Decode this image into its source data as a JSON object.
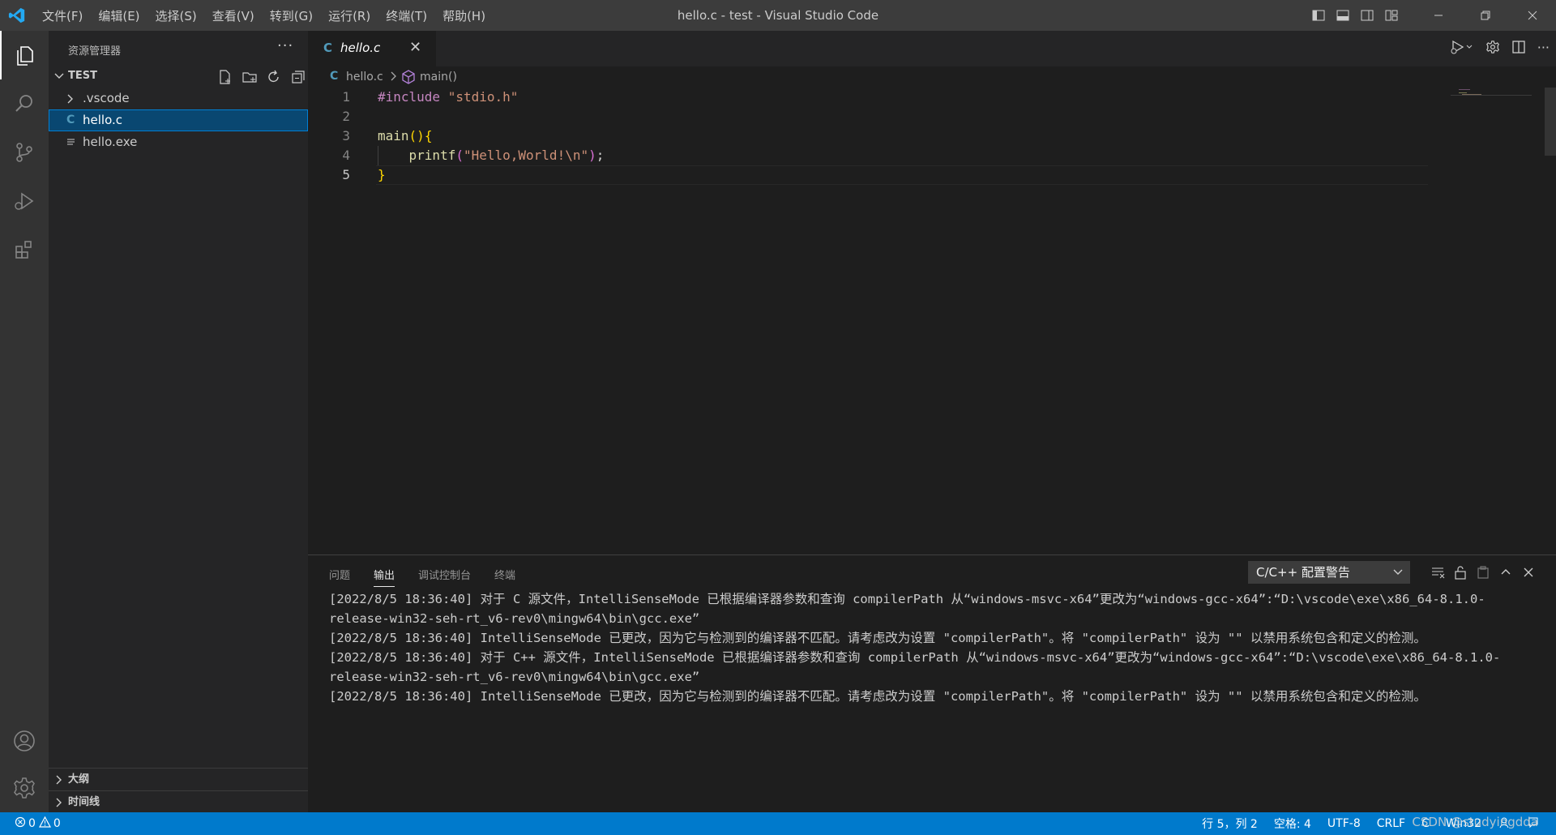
{
  "window": {
    "title": "hello.c - test - Visual Studio Code",
    "menu": [
      "文件(F)",
      "编辑(E)",
      "选择(S)",
      "查看(V)",
      "转到(G)",
      "运行(R)",
      "终端(T)",
      "帮助(H)"
    ]
  },
  "sidebar": {
    "header": "资源管理器",
    "more": "···",
    "section": "TEST",
    "items": [
      {
        "label": ".vscode",
        "type": "folder"
      },
      {
        "label": "hello.c",
        "type": "c-file",
        "icon_text": "C"
      },
      {
        "label": "hello.exe",
        "type": "file"
      }
    ],
    "outline": "大纲",
    "timeline": "时间线"
  },
  "tab": {
    "icon_text": "C",
    "label": "hello.c",
    "close": "✕"
  },
  "breadcrumb": {
    "icon_text": "C",
    "file": "hello.c",
    "symbol": "main()"
  },
  "editor": {
    "lines": [
      {
        "num": "1"
      },
      {
        "num": "2"
      },
      {
        "num": "3"
      },
      {
        "num": "4"
      },
      {
        "num": "5"
      }
    ],
    "tokens": {
      "include": "#include",
      "header": "\"stdio.h\"",
      "main": "main",
      "paren_open": "(",
      "paren_close": ")",
      "brace_open": "{",
      "printf": "printf",
      "lp": "(",
      "string": "\"Hello,World!\\n\"",
      "rp": ")",
      "semi": ";",
      "brace_close": "}"
    }
  },
  "panel": {
    "tabs": [
      "问题",
      "输出",
      "调试控制台",
      "终端"
    ],
    "active_tab": 1,
    "channel": "C/C++ 配置警告",
    "output": [
      "[2022/8/5 18:36:40] 对于 C 源文件，IntelliSenseMode 已根据编译器参数和查询 compilerPath 从“windows-msvc-x64”更改为“windows-gcc-x64”:“D:\\vscode\\exe\\x86_64-8.1.0-release-win32-seh-rt_v6-rev0\\mingw64\\bin\\gcc.exe”",
      "[2022/8/5 18:36:40] IntelliSenseMode 已更改，因为它与检测到的编译器不匹配。请考虑改为设置 \"compilerPath\"。将 \"compilerPath\" 设为 \"\" 以禁用系统包含和定义的检测。",
      "[2022/8/5 18:36:40] 对于 C++ 源文件，IntelliSenseMode 已根据编译器参数和查询 compilerPath 从“windows-msvc-x64”更改为“windows-gcc-x64”:“D:\\vscode\\exe\\x86_64-8.1.0-release-win32-seh-rt_v6-rev0\\mingw64\\bin\\gcc.exe”",
      "[2022/8/5 18:36:40] IntelliSenseMode 已更改，因为它与检测到的编译器不匹配。请考虑改为设置 \"compilerPath\"。将 \"compilerPath\" 设为 \"\" 以禁用系统包含和定义的检测。"
    ]
  },
  "status": {
    "errors": "0",
    "warnings": "0",
    "position": "行 5，列 2",
    "spaces": "空格: 4",
    "encoding": "UTF-8",
    "eol": "CRLF",
    "language": "C",
    "platform": "Win32",
    "watermark": "CSDN @studyingdda"
  },
  "colors": {
    "accent": "#007acc",
    "selection": "#094771",
    "c_icon": "#519aba"
  }
}
